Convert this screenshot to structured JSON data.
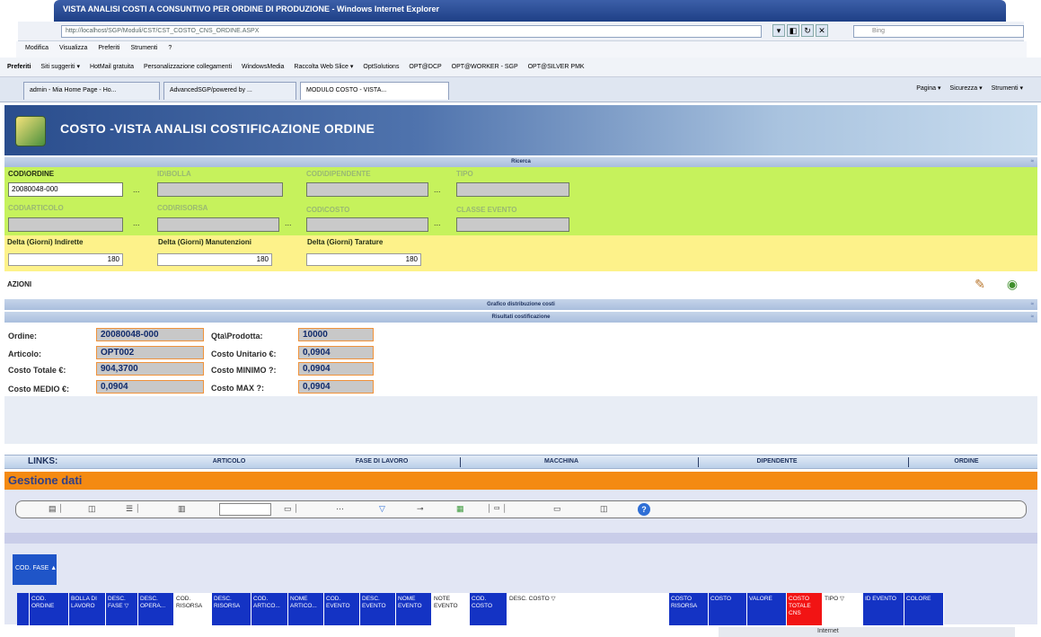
{
  "browser": {
    "title": "VISTA ANALISI COSTI A CONSUNTIVO PER ORDINE DI PRODUZIONE - Windows Internet Explorer",
    "url": "http://localhost/SGP/Moduli/CST/CST_COSTO_CNS_ORDINE.ASPX",
    "search_placeholder": "Bing",
    "menu": [
      "Modifica",
      "Visualizza",
      "Preferiti",
      "Strumenti",
      "?"
    ],
    "favorites_label": "Preferiti",
    "favorites": [
      "Siti suggeriti ▾",
      "HotMail gratuita",
      "Personalizzazione collegamenti",
      "WindowsMedia",
      "Raccolta Web Slice ▾",
      "OptSolutions",
      "OPT@DCP",
      "OPT@WORKER - SGP",
      "OPT@SILVER PMK"
    ],
    "tabs": [
      "admin - Mia Home Page - Ho...",
      "AdvancedSGP/powered by ...",
      "MODULO COSTO - VISTA..."
    ],
    "tab_tools": [
      "Pagina ▾",
      "Sicurezza ▾",
      "Strumenti ▾"
    ],
    "status_zone": "Internet"
  },
  "header": {
    "title": "COSTO -VISTA ANALISI COSTIFICAZIONE ORDINE"
  },
  "sections": {
    "ricerca": "Ricerca",
    "grafico": "Grafico distribuzione costi",
    "risultati": "Risultati costificazione"
  },
  "search": {
    "cod_ordine": {
      "label": "COD\\ORDINE",
      "value": "20080048-000"
    },
    "id_bolla": {
      "label": "ID\\BOLLA"
    },
    "cod_dipendente": {
      "label": "COD\\DIPENDENTE"
    },
    "tipo": {
      "label": "TIPO"
    },
    "cod_articolo": {
      "label": "COD\\ARTICOLO"
    },
    "cod_risorsa": {
      "label": "COD\\RISORSA"
    },
    "cod_costo": {
      "label": "COD\\COSTO"
    },
    "classe_evento": {
      "label": "CLASSE EVENTO"
    },
    "lookup": "..."
  },
  "delta": {
    "indirette": {
      "label": "Delta (Giorni) Indirette",
      "value": "180"
    },
    "manutenzioni": {
      "label": "Delta (Giorni) Manutenzioni",
      "value": "180"
    },
    "tarature": {
      "label": "Delta (Giorni) Tarature",
      "value": "180"
    }
  },
  "azioni": {
    "label": "AZIONI"
  },
  "results": {
    "ordine": {
      "label": "Ordine:",
      "value": "20080048-000"
    },
    "qta": {
      "label": "Qta\\Prodotta:",
      "value": "10000"
    },
    "articolo": {
      "label": "Articolo:",
      "value": "OPT002"
    },
    "costo_unitario": {
      "label": "Costo Unitario €:",
      "value": "0,0904"
    },
    "costo_totale": {
      "label": "Costo Totale €:",
      "value": "904,3700"
    },
    "costo_minimo": {
      "label": "Costo MINIMO ?:",
      "value": "0,0904"
    },
    "costo_medio": {
      "label": "Costo MEDIO €:",
      "value": "0,0904"
    },
    "costo_max": {
      "label": "Costo MAX ?:",
      "value": "0,0904"
    }
  },
  "links": {
    "title": "LINKS:",
    "items": [
      "ARTICOLO",
      "FASE DI LAVORO",
      "MACCHINA",
      "DIPENDENTE",
      "ORDINE"
    ]
  },
  "gestione": {
    "title": "Gestione dati"
  },
  "grid": {
    "groupby": "COD. FASE ▲",
    "columns": [
      "COD. ORDINE",
      "BOLLA DI LAVORO",
      "DESC. FASE ▽",
      "DESC. OPERA...",
      "COD. RISORSA",
      "DESC. RISORSA",
      "COD. ARTICO...",
      "NOME ARTICO...",
      "COD. EVENTO",
      "DESC. EVENTO",
      "NOME EVENTO",
      "NOTE EVENTO",
      "COD. COSTO",
      "DESC. COSTO ▽",
      "COSTO RISORSA",
      "COSTO",
      "VALORE",
      "COSTO TOTALE CNS",
      "TIPO ▽",
      "ID EVENTO",
      "COLORE"
    ],
    "help": "?"
  },
  "colors": {
    "search_bg": "#c6f25c",
    "delta_bg": "#fdf28a",
    "gestione_bg": "#f48a12",
    "column_header": "#1433c4"
  }
}
